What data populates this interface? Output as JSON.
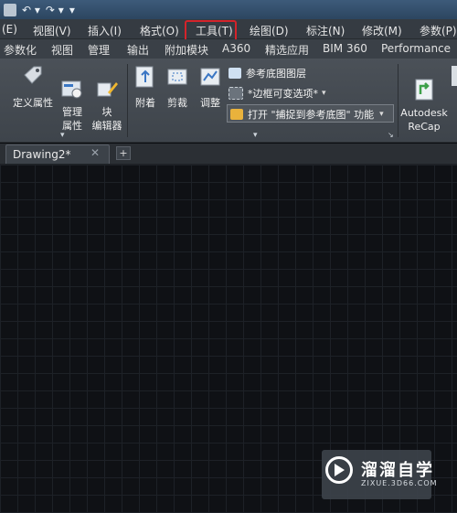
{
  "menubar": {
    "items": [
      "(E)",
      "视图(V)",
      "插入(I)",
      "格式(O)",
      "工具(T)",
      "绘图(D)",
      "标注(N)",
      "修改(M)",
      "参数(P)"
    ]
  },
  "ribbon_tabs": [
    "参数化",
    "视图",
    "管理",
    "输出",
    "附加模块",
    "A360",
    "精选应用",
    "BIM 360",
    "Performance"
  ],
  "ribbon": {
    "define_attr": "定义属性",
    "manage_attr": "管理\n属性",
    "block_editor": "块\n编辑器",
    "attach": "附着",
    "clip": "剪裁",
    "adjust": "调整",
    "ref_underlay_layers": "参考底图图层",
    "frames_vary": "*边框可变选项*",
    "snap_to_underlay": "打开 \"捕捉到参考底图\" 功能",
    "recap": "Autodesk\nReCap"
  },
  "file_tab": {
    "label": "Drawing2*",
    "close": "✕",
    "new_tab": "+"
  },
  "watermark": {
    "title": "溜溜自学",
    "url": "ZIXUE.3D66.COM"
  },
  "colors": {
    "accent_highlight": "#d4232a"
  }
}
